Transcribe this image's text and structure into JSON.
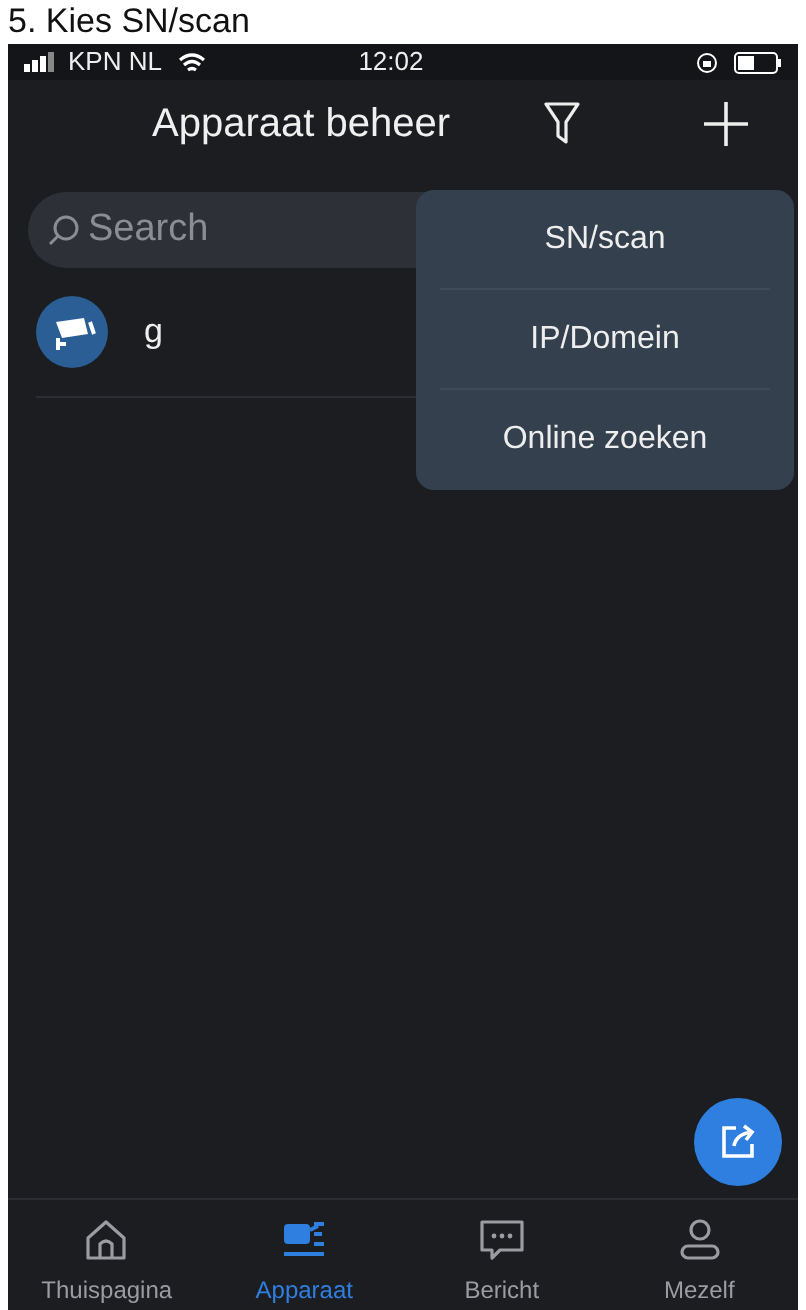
{
  "caption": "5. Kies SN/scan",
  "status_bar": {
    "carrier": "KPN NL",
    "time": "12:02"
  },
  "header": {
    "title": "Apparaat beheer"
  },
  "search": {
    "placeholder": "Search"
  },
  "devices": [
    {
      "name": "g"
    }
  ],
  "add_menu": {
    "items": [
      "SN/scan",
      "IP/Domein",
      "Online zoeken"
    ]
  },
  "tabs": [
    {
      "label": "Thuispagina",
      "kind": "home",
      "selected": false
    },
    {
      "label": "Apparaat",
      "kind": "device",
      "selected": true
    },
    {
      "label": "Bericht",
      "kind": "message",
      "selected": false
    },
    {
      "label": "Mezelf",
      "kind": "me",
      "selected": false
    }
  ]
}
